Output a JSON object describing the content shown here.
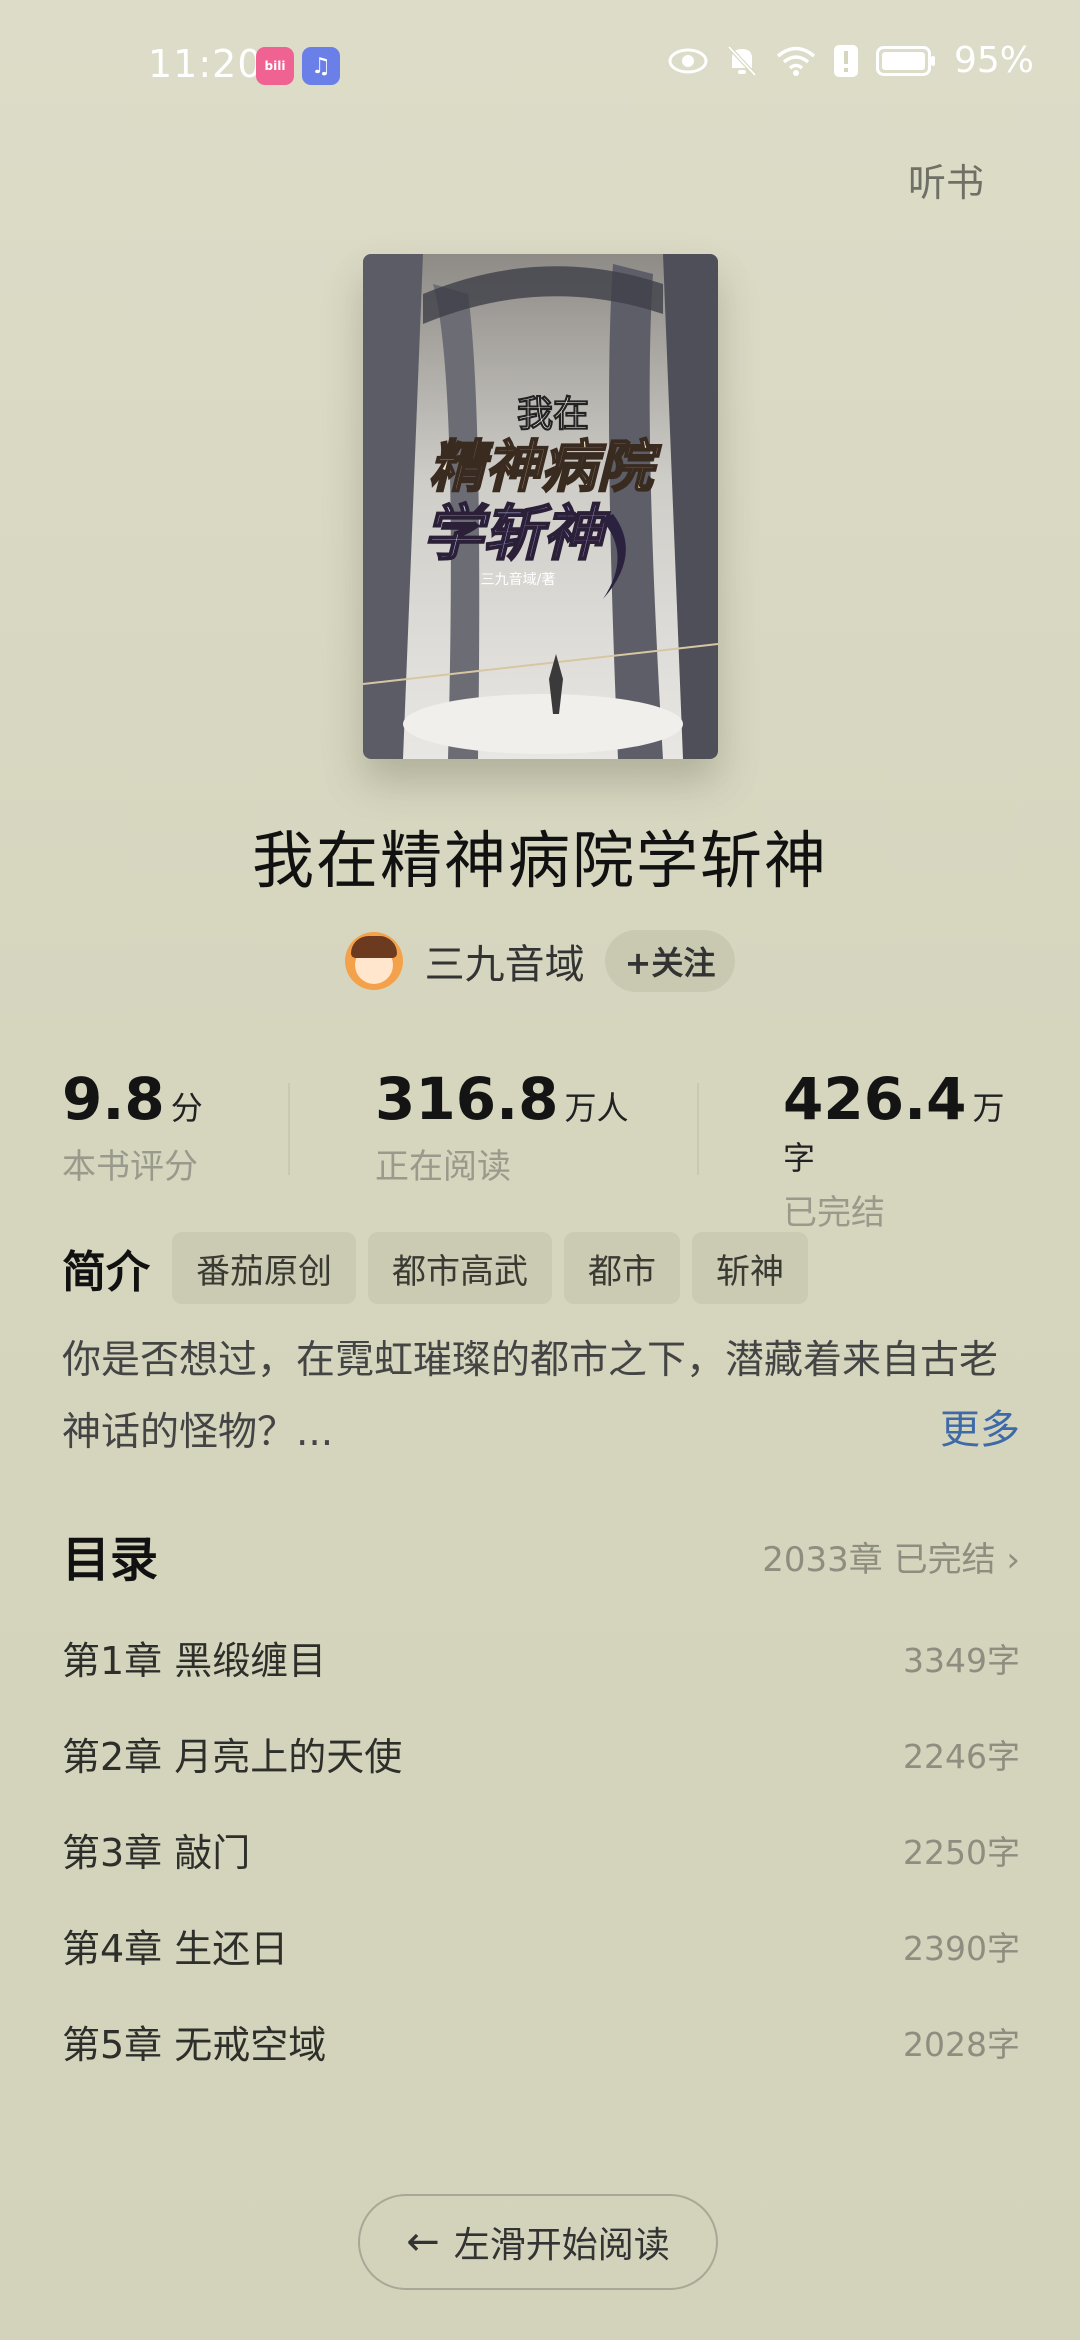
{
  "status_bar": {
    "time": "11:20",
    "app_badges": [
      "bilibili-icon",
      "music-icon"
    ],
    "battery": "95%",
    "icons": [
      "eye-icon",
      "mute-bell-icon",
      "wifi-icon",
      "alert-icon",
      "battery-icon"
    ]
  },
  "header": {
    "listen_label": "听书"
  },
  "book": {
    "cover_title_lines": [
      "我在",
      "精神病院",
      "学斩神"
    ],
    "cover_author": "三九音域/著",
    "title": "我在精神病院学斩神",
    "author": "三九音域",
    "follow_label": "+关注"
  },
  "stats": [
    {
      "value": "9.8",
      "unit": "分",
      "label": "本书评分"
    },
    {
      "value": "316.8",
      "unit": "万人",
      "label": "正在阅读"
    },
    {
      "value": "426.4",
      "unit": "万字",
      "label": "已完结"
    }
  ],
  "intro": {
    "label": "简介",
    "tags": [
      "番茄原创",
      "都市高武",
      "都市",
      "斩神"
    ],
    "text": "你是否想过，在霓虹璀璨的都市之下，潜藏着来自古老神话的怪物？...",
    "more_label": "更多"
  },
  "catalog": {
    "title": "目录",
    "info": "2033章 已完结 ›",
    "chapters": [
      {
        "title": "第1章 黑缎缠目",
        "words": "3349字"
      },
      {
        "title": "第2章 月亮上的天使",
        "words": "2246字"
      },
      {
        "title": "第3章 敲门",
        "words": "2250字"
      },
      {
        "title": "第4章 生还日",
        "words": "2390字"
      },
      {
        "title": "第5章 无戒空域",
        "words": "2028字"
      }
    ]
  },
  "start_reading": {
    "label": "左滑开始阅读",
    "icon": "arrow-left-icon"
  },
  "colors": {
    "background": "#d8d8c2",
    "link": "#3e6aa8",
    "tag_bg": "#cbcbb3"
  }
}
